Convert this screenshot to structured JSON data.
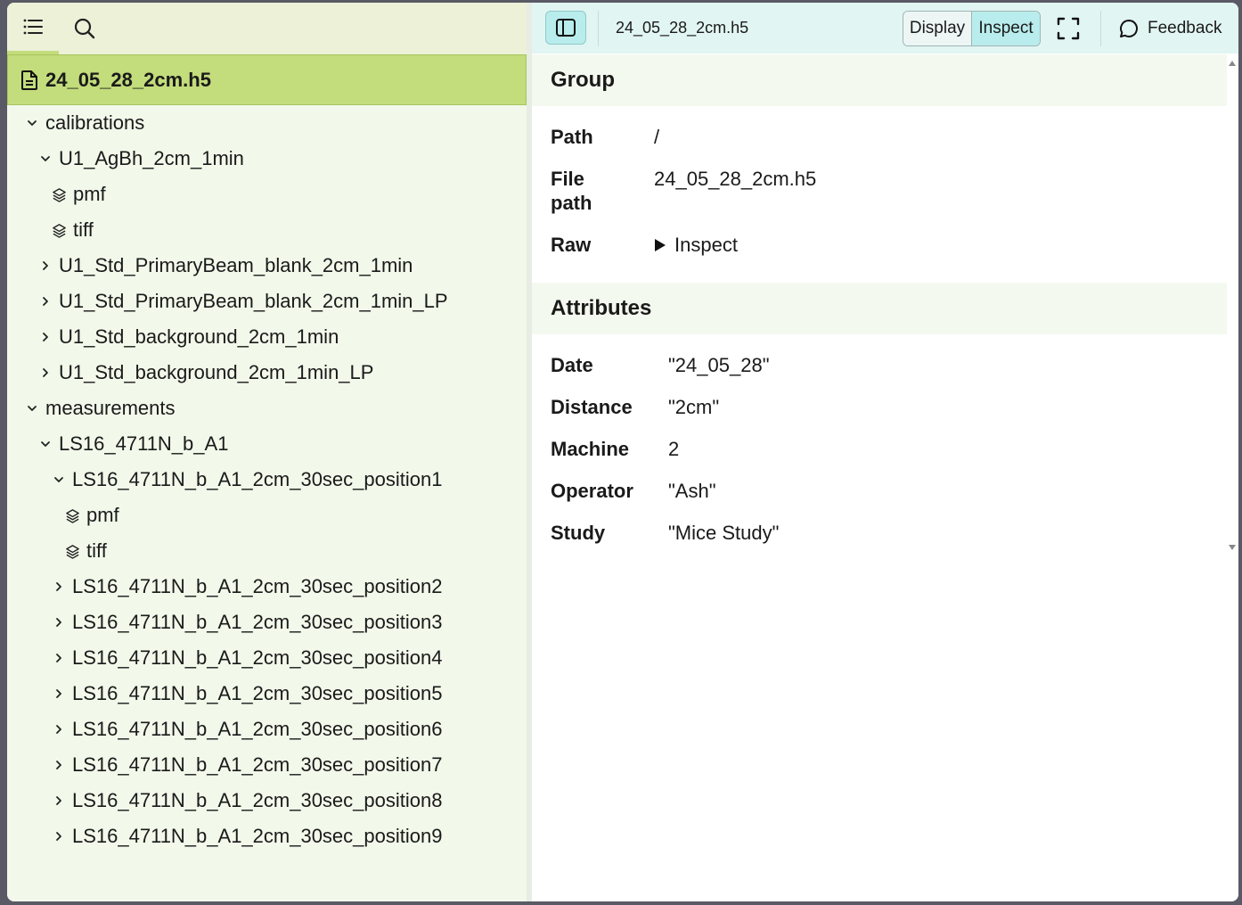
{
  "sidebar": {
    "tabs": [
      {
        "name": "explorer",
        "icon": "list-icon"
      },
      {
        "name": "search",
        "icon": "search-icon"
      }
    ],
    "root_file": "24_05_28_2cm.h5",
    "tree": [
      {
        "label": "calibrations",
        "type": "group",
        "expanded": true,
        "depth": 0
      },
      {
        "label": "U1_AgBh_2cm_1min",
        "type": "group",
        "expanded": true,
        "depth": 1
      },
      {
        "label": "pmf",
        "type": "dataset",
        "depth": 2
      },
      {
        "label": "tiff",
        "type": "dataset",
        "depth": 2
      },
      {
        "label": "U1_Std_PrimaryBeam_blank_2cm_1min",
        "type": "group",
        "expanded": false,
        "depth": 1
      },
      {
        "label": "U1_Std_PrimaryBeam_blank_2cm_1min_LP",
        "type": "group",
        "expanded": false,
        "depth": 1
      },
      {
        "label": "U1_Std_background_2cm_1min",
        "type": "group",
        "expanded": false,
        "depth": 1
      },
      {
        "label": "U1_Std_background_2cm_1min_LP",
        "type": "group",
        "expanded": false,
        "depth": 1
      },
      {
        "label": "measurements",
        "type": "group",
        "expanded": true,
        "depth": 0
      },
      {
        "label": "LS16_4711N_b_A1",
        "type": "group",
        "expanded": true,
        "depth": 1
      },
      {
        "label": "LS16_4711N_b_A1_2cm_30sec_position1",
        "type": "group",
        "expanded": true,
        "depth": 2
      },
      {
        "label": "pmf",
        "type": "dataset",
        "depth": 3
      },
      {
        "label": "tiff",
        "type": "dataset",
        "depth": 3
      },
      {
        "label": "LS16_4711N_b_A1_2cm_30sec_position2",
        "type": "group",
        "expanded": false,
        "depth": 2
      },
      {
        "label": "LS16_4711N_b_A1_2cm_30sec_position3",
        "type": "group",
        "expanded": false,
        "depth": 2
      },
      {
        "label": "LS16_4711N_b_A1_2cm_30sec_position4",
        "type": "group",
        "expanded": false,
        "depth": 2
      },
      {
        "label": "LS16_4711N_b_A1_2cm_30sec_position5",
        "type": "group",
        "expanded": false,
        "depth": 2
      },
      {
        "label": "LS16_4711N_b_A1_2cm_30sec_position6",
        "type": "group",
        "expanded": false,
        "depth": 2
      },
      {
        "label": "LS16_4711N_b_A1_2cm_30sec_position7",
        "type": "group",
        "expanded": false,
        "depth": 2
      },
      {
        "label": "LS16_4711N_b_A1_2cm_30sec_position8",
        "type": "group",
        "expanded": false,
        "depth": 2
      },
      {
        "label": "LS16_4711N_b_A1_2cm_30sec_position9",
        "type": "group",
        "expanded": false,
        "depth": 2
      }
    ]
  },
  "toolbar": {
    "file_title": "24_05_28_2cm.h5",
    "display_label": "Display",
    "inspect_label": "Inspect",
    "active_mode": "Inspect",
    "feedback_label": "Feedback"
  },
  "group": {
    "heading": "Group",
    "path_key": "Path",
    "path_value": "/",
    "file_path_key": "File path",
    "file_path_value": "24_05_28_2cm.h5",
    "raw_key": "Raw",
    "raw_value": "Inspect"
  },
  "attributes": {
    "heading": "Attributes",
    "items": [
      {
        "key": "Date",
        "value": "\"24_05_28\""
      },
      {
        "key": "Distance",
        "value": "\"2cm\""
      },
      {
        "key": "Machine",
        "value": "2"
      },
      {
        "key": "Operator",
        "value": "\"Ash\""
      },
      {
        "key": "Study",
        "value": "\"Mice Study\""
      }
    ]
  },
  "colors": {
    "sidebar_bg": "#f2f8ea",
    "selected_bg": "#c3dc7c",
    "toolbar_bg": "#e1f5f2",
    "accent": "#b9ecec",
    "section_bg": "#f4f9ef"
  }
}
